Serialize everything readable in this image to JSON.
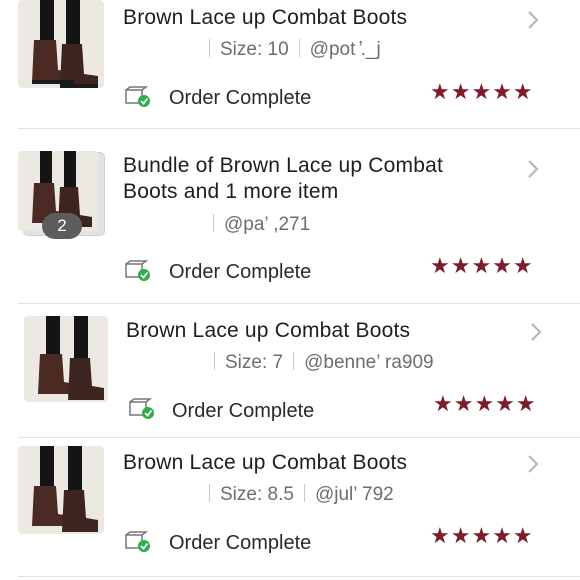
{
  "orders": [
    {
      "title": "Brown Lace up Combat Boots",
      "size": "Size: 10",
      "seller": "@pot  ̓._j",
      "status": "Order Complete",
      "rating_stars": 5,
      "stars": "★★★★★"
    },
    {
      "title": "Bundle of Brown Lace up Combat Boots and 1 more item",
      "bundle_count": "2",
      "seller": "@pa’   ,271",
      "status": "Order Complete",
      "rating_stars": 5,
      "stars": "★★★★★"
    },
    {
      "title": "Brown Lace up Combat Boots",
      "size": "Size: 7",
      "seller": "@benne’     ra909",
      "status": "Order Complete",
      "rating_stars": 5,
      "stars": "★★★★★"
    },
    {
      "title": "Brown Lace up Combat Boots",
      "size": "Size: 8.5",
      "seller": "@jul’    792",
      "status": "Order Complete",
      "rating_stars": 5,
      "stars": "★★★★★"
    }
  ],
  "colors": {
    "star": "#7d1c2b",
    "status_check": "#2fae4c",
    "divider": "#e2e2e2"
  },
  "icons": {
    "chevron": "chevron-right-icon",
    "status": "package-check-icon",
    "star": "star-icon"
  }
}
